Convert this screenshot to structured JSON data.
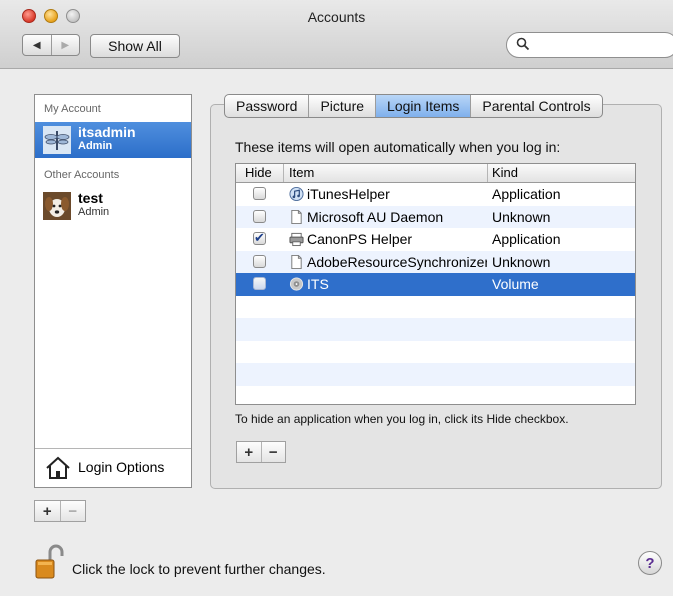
{
  "window": {
    "title": "Accounts"
  },
  "toolbar": {
    "back_icon": "◀",
    "forward_icon": "▶",
    "show_all_label": "Show All",
    "search_icon": "🔍",
    "search_value": "",
    "search_placeholder": ""
  },
  "sidebar": {
    "my_account_header": "My Account",
    "my_account": {
      "name": "itsadmin",
      "role": "Admin"
    },
    "other_accounts_header": "Other Accounts",
    "other_accounts": [
      {
        "name": "test",
        "role": "Admin"
      }
    ],
    "login_options_label": "Login Options",
    "add_symbol": "+",
    "remove_symbol": "−"
  },
  "tabs": [
    {
      "label": "Password",
      "active": false
    },
    {
      "label": "Picture",
      "active": false
    },
    {
      "label": "Login Items",
      "active": true
    },
    {
      "label": "Parental Controls",
      "active": false
    }
  ],
  "login_items": {
    "intro": "These items will open automatically when you log in:",
    "columns": {
      "hide": "Hide",
      "item": "Item",
      "kind": "Kind"
    },
    "rows": [
      {
        "hide": false,
        "name": "iTunesHelper",
        "kind": "Application",
        "icon": "app-icon",
        "selected": false
      },
      {
        "hide": false,
        "name": "Microsoft AU Daemon",
        "kind": "Unknown",
        "icon": "document-icon",
        "selected": false
      },
      {
        "hide": true,
        "name": "CanonPS Helper",
        "kind": "Application",
        "icon": "app-icon",
        "selected": false
      },
      {
        "hide": false,
        "name": "AdobeResourceSynchronizer",
        "kind": "Unknown",
        "icon": "document-icon",
        "selected": false
      },
      {
        "hide": false,
        "name": "ITS",
        "kind": "Volume",
        "icon": "volume-icon",
        "selected": true
      }
    ],
    "hint": "To hide an application when you log in, click its Hide checkbox.",
    "add_symbol": "+",
    "remove_symbol": "−"
  },
  "footer": {
    "lock_text": "Click the lock to prevent further changes.",
    "help_symbol": "?"
  }
}
